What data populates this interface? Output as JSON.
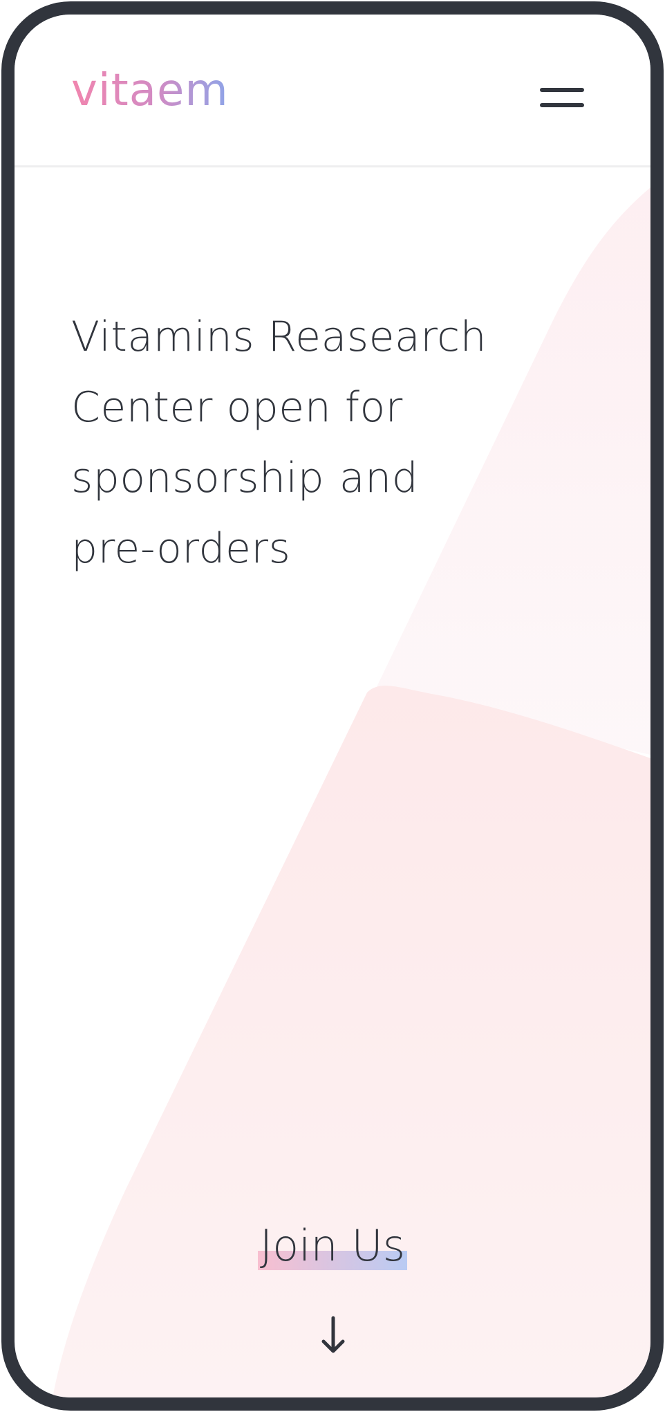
{
  "header": {
    "logo_text": "vitaem",
    "menu_icon": "hamburger-menu-icon"
  },
  "hero": {
    "line1": "Vitamins Reasearch",
    "line2": "Center open for",
    "line3_highlight": "sponsorship",
    "line3_rest": " and",
    "line4_highlight": "pre-orders"
  },
  "cta": {
    "label": "Join Us",
    "arrow_icon": "arrow-down-icon"
  },
  "colors": {
    "frame": "#31353d",
    "text": "#31353d",
    "logo_gradient_start": "#f185ae",
    "logo_gradient_end": "#8ea4e8",
    "highlight_start": "#f8bfd0",
    "highlight_end": "#b9cbf3",
    "background_shape": "#fde9ea"
  }
}
